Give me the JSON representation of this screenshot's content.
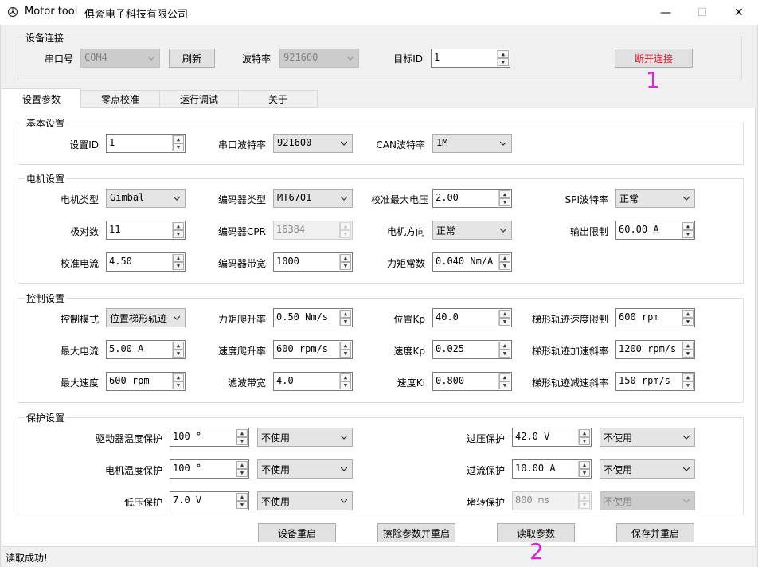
{
  "window": {
    "app_name": "Motor tool",
    "company": "俱瓷电子科技有限公司",
    "minimize": "—",
    "maximize": "☐",
    "close": "✕"
  },
  "connection": {
    "group_title": "设备连接",
    "port_label": "串口号",
    "port_value": "COM4",
    "refresh_label": "刷新",
    "baud_label": "波特率",
    "baud_value": "921600",
    "target_id_label": "目标ID",
    "target_id_value": "1",
    "disconnect_label": "断开连接",
    "marker": "1"
  },
  "tabs": [
    {
      "label": "设置参数",
      "active": true
    },
    {
      "label": "零点校准",
      "active": false
    },
    {
      "label": "运行调试",
      "active": false
    },
    {
      "label": "关于",
      "active": false
    }
  ],
  "basic": {
    "title": "基本设置",
    "id_label": "设置ID",
    "id_value": "1",
    "uart_label": "串口波特率",
    "uart_value": "921600",
    "can_label": "CAN波特率",
    "can_value": "1M"
  },
  "motor": {
    "title": "电机设置",
    "type_label": "电机类型",
    "type_value": "Gimbal",
    "encoder_type_label": "编码器类型",
    "encoder_type_value": "MT6701",
    "cal_voltage_label": "校准最大电压",
    "cal_voltage_value": "2.00",
    "spi_label": "SPI波特率",
    "spi_value": "正常",
    "pole_label": "极对数",
    "pole_value": "11",
    "cpr_label": "编码器CPR",
    "cpr_value": "16384",
    "direction_label": "电机方向",
    "direction_value": "正常",
    "output_limit_label": "输出限制",
    "output_limit_value": "60.00 A",
    "cal_current_label": "校准电流",
    "cal_current_value": "4.50",
    "encoder_bw_label": "编码器带宽",
    "encoder_bw_value": "1000",
    "torque_const_label": "力矩常数",
    "torque_const_value": "0.040 Nm/A"
  },
  "control": {
    "title": "控制设置",
    "mode_label": "控制模式",
    "mode_value": "位置梯形轨迹",
    "torque_ramp_label": "力矩爬升率",
    "torque_ramp_value": "0.50 Nm/s",
    "pos_kp_label": "位置Kp",
    "pos_kp_value": "40.0",
    "traj_vel_label": "梯形轨迹速度限制",
    "traj_vel_value": "600 rpm",
    "max_current_label": "最大电流",
    "max_current_value": "5.00 A",
    "vel_ramp_label": "速度爬升率",
    "vel_ramp_value": "600 rpm/s",
    "vel_kp_label": "速度Kp",
    "vel_kp_value": "0.025",
    "traj_accel_label": "梯形轨迹加速斜率",
    "traj_accel_value": "1200 rpm/s",
    "max_speed_label": "最大速度",
    "max_speed_value": "600 rpm",
    "filter_bw_label": "滤波带宽",
    "filter_bw_value": "4.0",
    "vel_ki_label": "速度Ki",
    "vel_ki_value": "0.800",
    "traj_decel_label": "梯形轨迹减速斜率",
    "traj_decel_value": "150 rpm/s"
  },
  "protection": {
    "title": "保护设置",
    "driver_temp_label": "驱动器温度保护",
    "driver_temp_value": "100 °",
    "driver_temp_mode": "不使用",
    "motor_temp_label": "电机温度保护",
    "motor_temp_value": "100 °",
    "motor_temp_mode": "不使用",
    "undervolt_label": "低压保护",
    "undervolt_value": "7.0 V",
    "undervolt_mode": "不使用",
    "overvolt_label": "过压保护",
    "overvolt_value": "42.0 V",
    "overvolt_mode": "不使用",
    "overcurrent_label": "过流保护",
    "overcurrent_value": "10.00 A",
    "overcurrent_mode": "不使用",
    "stall_label": "堵转保护",
    "stall_value": "800 ms",
    "stall_mode": "不使用"
  },
  "actions": {
    "restart_label": "设备重启",
    "erase_label": "擦除参数并重启",
    "read_label": "读取参数",
    "save_label": "保存并重启",
    "marker": "2"
  },
  "status": {
    "text": "读取成功!"
  },
  "colors": {
    "accent_red": "#e0203a",
    "marker_magenta": "#e020e0"
  }
}
